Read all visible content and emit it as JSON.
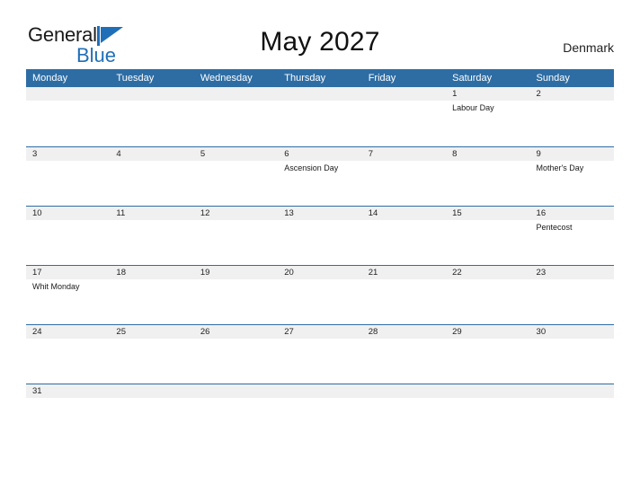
{
  "brand": {
    "word_black": "General",
    "word_blue": "Blue",
    "flag_icon": "blue-triangle-flag-icon",
    "accent_color": "#1f6fb8"
  },
  "header": {
    "title": "May 2027",
    "region": "Denmark"
  },
  "colors": {
    "header_blue": "#2E6DA4",
    "date_strip": "#F0F0F0",
    "text": "#222222"
  },
  "calendar": {
    "weekdays": [
      "Monday",
      "Tuesday",
      "Wednesday",
      "Thursday",
      "Friday",
      "Saturday",
      "Sunday"
    ],
    "weeks": [
      {
        "days": [
          {
            "date": "",
            "events": []
          },
          {
            "date": "",
            "events": []
          },
          {
            "date": "",
            "events": []
          },
          {
            "date": "",
            "events": []
          },
          {
            "date": "",
            "events": []
          },
          {
            "date": "1",
            "events": [
              "Labour Day"
            ]
          },
          {
            "date": "2",
            "events": []
          }
        ]
      },
      {
        "days": [
          {
            "date": "3",
            "events": []
          },
          {
            "date": "4",
            "events": []
          },
          {
            "date": "5",
            "events": []
          },
          {
            "date": "6",
            "events": [
              "Ascension Day"
            ]
          },
          {
            "date": "7",
            "events": []
          },
          {
            "date": "8",
            "events": []
          },
          {
            "date": "9",
            "events": [
              "Mother's Day"
            ]
          }
        ]
      },
      {
        "days": [
          {
            "date": "10",
            "events": []
          },
          {
            "date": "11",
            "events": []
          },
          {
            "date": "12",
            "events": []
          },
          {
            "date": "13",
            "events": []
          },
          {
            "date": "14",
            "events": []
          },
          {
            "date": "15",
            "events": []
          },
          {
            "date": "16",
            "events": [
              "Pentecost"
            ]
          }
        ]
      },
      {
        "days": [
          {
            "date": "17",
            "events": [
              "Whit Monday"
            ]
          },
          {
            "date": "18",
            "events": []
          },
          {
            "date": "19",
            "events": []
          },
          {
            "date": "20",
            "events": []
          },
          {
            "date": "21",
            "events": []
          },
          {
            "date": "22",
            "events": []
          },
          {
            "date": "23",
            "events": []
          }
        ]
      },
      {
        "days": [
          {
            "date": "24",
            "events": []
          },
          {
            "date": "25",
            "events": []
          },
          {
            "date": "26",
            "events": []
          },
          {
            "date": "27",
            "events": []
          },
          {
            "date": "28",
            "events": []
          },
          {
            "date": "29",
            "events": []
          },
          {
            "date": "30",
            "events": []
          }
        ]
      },
      {
        "short": true,
        "days": [
          {
            "date": "31",
            "events": []
          },
          {
            "date": "",
            "events": []
          },
          {
            "date": "",
            "events": []
          },
          {
            "date": "",
            "events": []
          },
          {
            "date": "",
            "events": []
          },
          {
            "date": "",
            "events": []
          },
          {
            "date": "",
            "events": []
          }
        ]
      }
    ]
  }
}
